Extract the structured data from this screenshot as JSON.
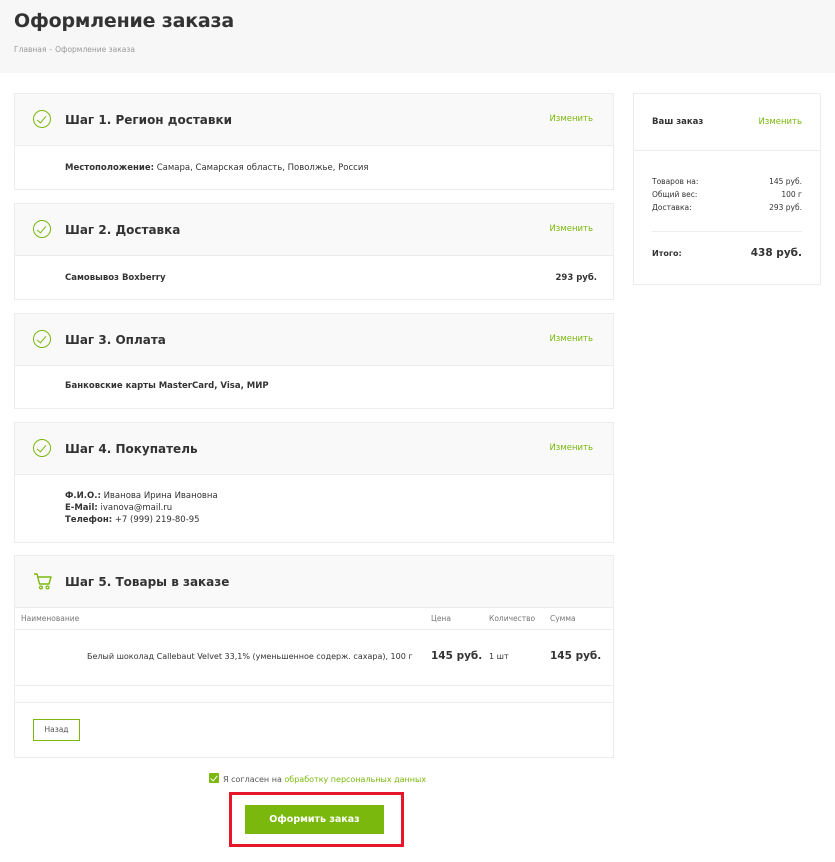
{
  "page": {
    "title": "Оформление заказа",
    "breadcrumb": [
      "Главная",
      "Оформление заказа"
    ],
    "breadcrumb_sep": "-"
  },
  "steps": [
    {
      "title": "Шаг 1. Регион доставки",
      "change": "Изменить",
      "icon": "check-circle-icon",
      "location_label": "Местоположение:",
      "location_value": "Самара, Самарская область, Поволжье, Россия"
    },
    {
      "title": "Шаг 2. Доставка",
      "change": "Изменить",
      "icon": "check-circle-icon",
      "method": "Самовывоз Boxberry",
      "price": "293 руб."
    },
    {
      "title": "Шаг 3. Оплата",
      "change": "Изменить",
      "icon": "check-circle-icon",
      "method": "Банковские карты MasterCard, Visa, МИР"
    },
    {
      "title": "Шаг 4. Покупатель",
      "change": "Изменить",
      "icon": "check-circle-icon",
      "fio_label": "Ф.И.О.:",
      "fio_value": "Иванова Ирина Ивановна",
      "email_label": "E-Mail:",
      "email_value": "ivanova@mail.ru",
      "phone_label": "Телефон:",
      "phone_value": "+7 (999) 219-80-95"
    },
    {
      "title": "Шаг 5. Товары в заказе",
      "icon": "cart-icon",
      "columns": [
        "Наименование",
        "Цена",
        "Количество",
        "Сумма"
      ],
      "items": [
        {
          "name": "Белый шоколад Callebaut Velvet 33,1% (уменьшенное содерж. сахара), 100 г",
          "price": "145 руб.",
          "qty": "1 шт",
          "sum": "145 руб."
        }
      ],
      "back_label": "Назад"
    }
  ],
  "summary": {
    "title": "Ваш заказ",
    "change": "Изменить",
    "lines": [
      {
        "label": "Товаров на:",
        "value": "145 руб."
      },
      {
        "label": "Общий вес:",
        "value": "100 г"
      },
      {
        "label": "Доставка:",
        "value": "293 руб."
      }
    ],
    "total_label": "Итого:",
    "total_value": "438 руб."
  },
  "agreement": {
    "checked": true,
    "text": "Я согласен на",
    "link": "обработку персональных данных"
  },
  "submit_label": "Оформить заказ",
  "colors": {
    "accent": "#7ab80e",
    "highlight": "#e8162a"
  }
}
